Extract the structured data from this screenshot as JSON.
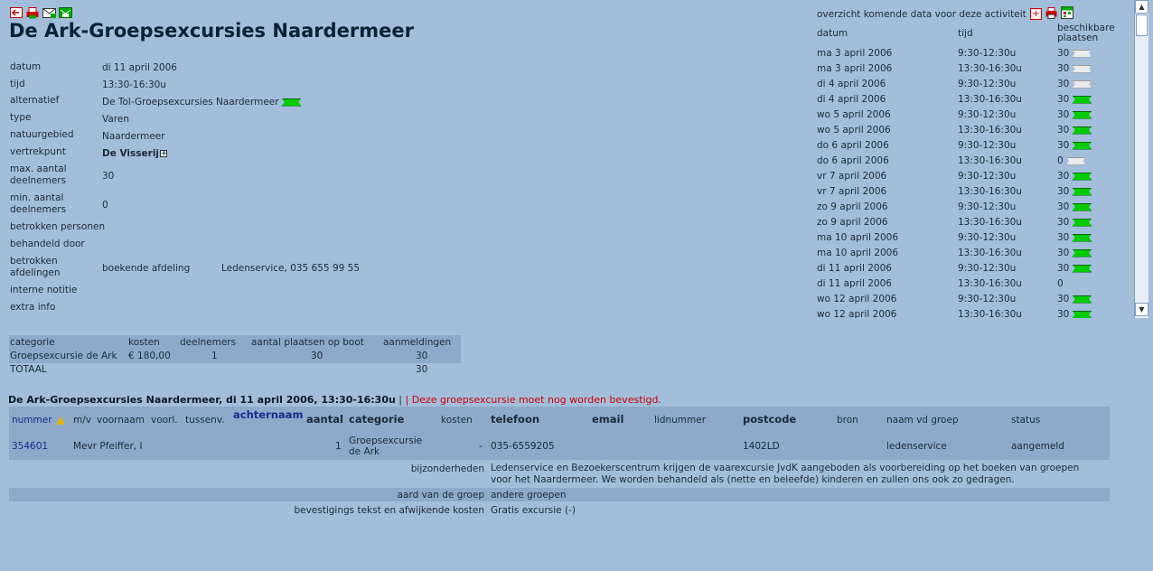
{
  "toolbar": {
    "icons": [
      "back-icon",
      "print-icon",
      "mail-icon",
      "mail-send-icon"
    ]
  },
  "page_title": "De Ark-Groepsexcursies Naardermeer",
  "details": {
    "datum_label": "datum",
    "datum": "di 11 april 2006",
    "tijd_label": "tijd",
    "tijd": "13:30-16:30u",
    "alternatief_label": "alternatief",
    "alternatief": "De Tol-Groepsexcursies Naardermeer",
    "type_label": "type",
    "type": "Varen",
    "natuurgebied_label": "natuurgebied",
    "natuurgebied": "Naardermeer",
    "vertrekpunt_label": "vertrekpunt",
    "vertrekpunt": "De Visserij",
    "max_label_1": "max. aantal",
    "max_label_2": "deelnemers",
    "max": "30",
    "min_label_1": "min. aantal",
    "min_label_2": "deelnemers",
    "min": "0",
    "betrokken_personen_label": "betrokken personen",
    "behandeld_door_label": "behandeld door",
    "betrokken_afd_label_1": "betrokken",
    "betrokken_afd_label_2": "afdelingen",
    "boekende_afdeling": "boekende afdeling",
    "boekende_afdeling_value": "Ledenservice, 035 655 99 55",
    "interne_notitie_label": "interne notitie",
    "extra_info_label": "extra info"
  },
  "upcoming": {
    "heading": "overzicht komende data voor deze activiteit",
    "col_datum": "datum",
    "col_tijd": "tijd",
    "col_av_1": "beschikbare",
    "col_av_2": "plaatsen",
    "rows": [
      {
        "date": "ma 3 april 2006",
        "time": "9:30-12:30u",
        "avail": "30",
        "ticket": "grey"
      },
      {
        "date": "ma 3 april 2006",
        "time": "13:30-16:30u",
        "avail": "30",
        "ticket": "grey"
      },
      {
        "date": "di 4 april 2006",
        "time": "9:30-12:30u",
        "avail": "30",
        "ticket": "grey"
      },
      {
        "date": "di 4 april 2006",
        "time": "13:30-16:30u",
        "avail": "30",
        "ticket": "green"
      },
      {
        "date": "wo 5 april 2006",
        "time": "9:30-12:30u",
        "avail": "30",
        "ticket": "green"
      },
      {
        "date": "wo 5 april 2006",
        "time": "13:30-16:30u",
        "avail": "30",
        "ticket": "green"
      },
      {
        "date": "do 6 april 2006",
        "time": "9:30-12:30u",
        "avail": "30",
        "ticket": "green"
      },
      {
        "date": "do 6 april 2006",
        "time": "13:30-16:30u",
        "avail": "0",
        "ticket": "grey"
      },
      {
        "date": "vr 7 april 2006",
        "time": "9:30-12:30u",
        "avail": "30",
        "ticket": "green"
      },
      {
        "date": "vr 7 april 2006",
        "time": "13:30-16:30u",
        "avail": "30",
        "ticket": "green"
      },
      {
        "date": "zo 9 april 2006",
        "time": "9:30-12:30u",
        "avail": "30",
        "ticket": "green"
      },
      {
        "date": "zo 9 april 2006",
        "time": "13:30-16:30u",
        "avail": "30",
        "ticket": "green"
      },
      {
        "date": "ma 10 april 2006",
        "time": "9:30-12:30u",
        "avail": "30",
        "ticket": "green"
      },
      {
        "date": "ma 10 april 2006",
        "time": "13:30-16:30u",
        "avail": "30",
        "ticket": "green"
      },
      {
        "date": "di 11 april 2006",
        "time": "9:30-12:30u",
        "avail": "30",
        "ticket": "green"
      },
      {
        "date": "di 11 april 2006",
        "time": "13:30-16:30u",
        "avail": "0",
        "ticket": "none"
      },
      {
        "date": "wo 12 april 2006",
        "time": "9:30-12:30u",
        "avail": "30",
        "ticket": "green"
      },
      {
        "date": "wo 12 april 2006",
        "time": "13:30-16:30u",
        "avail": "30",
        "ticket": "green"
      }
    ]
  },
  "categories": {
    "headers": [
      "categorie",
      "kosten",
      "deelnemers",
      "aantal plaatsen op boot",
      "aanmeldingen"
    ],
    "row": [
      "Groepsexcursie de Ark",
      "€ 180,00",
      "1",
      "30",
      "30"
    ],
    "total_label": "TOTAAL",
    "total_value": "30"
  },
  "booking": {
    "heading": "De Ark-Groepsexcursies Naardermeer, di 11 april 2006, 13:30-16:30u",
    "separator": " | ",
    "warning": "| Deze groepsexcursie moet nog worden bevestigd.",
    "headers": {
      "nummer": "nummer",
      "mv": "m/v",
      "voornaam": "voornaam",
      "voorl": "voorl.",
      "tussenv": "tussenv.",
      "achternaam": "achternaam",
      "aantal": "aantal",
      "categorie": "categorie",
      "kosten": "kosten",
      "telefoon": "telefoon",
      "email": "email",
      "lidnummer": "lidnummer",
      "postcode": "postcode",
      "bron": "bron",
      "naam_groep": "naam vd groep",
      "status": "status"
    },
    "row": {
      "nummer": "354601",
      "naam": "Mevr Pfeiffer, I",
      "aantal": "1",
      "categorie_1": "Groepsexcursie",
      "categorie_2": "de Ark",
      "kosten": "-",
      "telefoon": "035-6559205",
      "postcode": "1402LD",
      "naam_groep": "ledenservice",
      "status": "aangemeld"
    },
    "bijzonderheden_label": "bijzonderheden",
    "bijzonderheden": "Ledenservice en Bezoekerscentrum krijgen de vaarexcursie JvdK aangeboden als voorbereiding op het boeken van groepen voor het Naardermeer. We worden behandeld als (nette en beleefde) kinderen en zullen ons ook zo gedragen.",
    "aard_label": "aard van de groep",
    "aard": "andere groepen",
    "bevestiging_label": "bevestigings tekst en afwijkende kosten",
    "bevestiging": "Gratis excursie (-)"
  },
  "colors": {
    "background": "#a3bedb",
    "table_band": "#8eaacb",
    "ticket_green": "#00cc00",
    "warning_red": "#cc0000"
  }
}
